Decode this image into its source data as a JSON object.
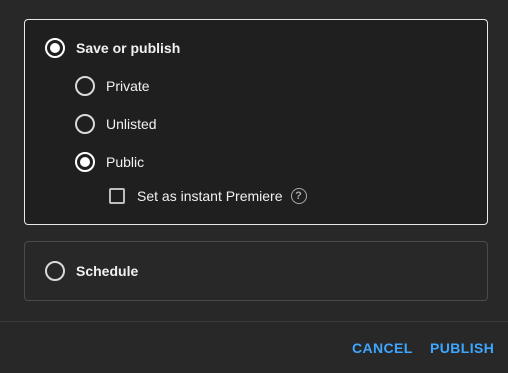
{
  "visibility": {
    "save_or_publish": {
      "label": "Save or publish",
      "selected": true
    },
    "options": [
      {
        "label": "Private",
        "selected": false
      },
      {
        "label": "Unlisted",
        "selected": false
      },
      {
        "label": "Public",
        "selected": true
      }
    ],
    "premiere": {
      "label": "Set as instant Premiere",
      "checked": false,
      "help_icon": "help-circle-icon",
      "help_glyph": "?"
    }
  },
  "schedule": {
    "label": "Schedule",
    "selected": false
  },
  "footer": {
    "cancel_label": "CANCEL",
    "publish_label": "PUBLISH"
  },
  "colors": {
    "background": "#282828",
    "panel_selected_bg": "#1f1f1f",
    "accent": "#3ea6ff",
    "text": "#f1f1f1"
  }
}
